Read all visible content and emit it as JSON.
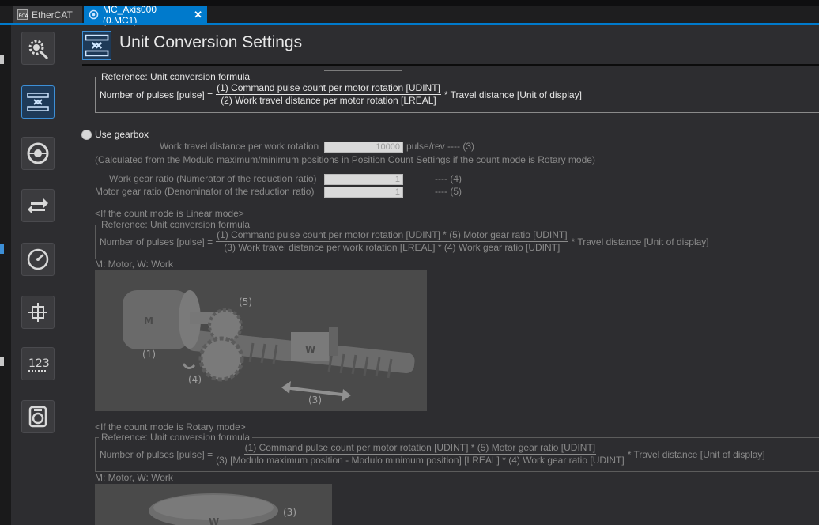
{
  "tabs": [
    {
      "label": "EtherCAT",
      "active": false,
      "icon": "ecat-icon"
    },
    {
      "label": "MC_Axis000 (0,MC1)",
      "active": true,
      "icon": "axis-icon",
      "close": "✕"
    }
  ],
  "sidebar": {
    "buttons": [
      {
        "name": "axis-basic-settings",
        "icon": "gear-icon"
      },
      {
        "name": "unit-conversion-settings",
        "icon": "unit-conversion-icon",
        "active": true
      },
      {
        "name": "operation-settings",
        "icon": "motor-icon"
      },
      {
        "name": "other-operation-settings",
        "icon": "arrows-icon"
      },
      {
        "name": "limit-settings",
        "icon": "speedometer-icon"
      },
      {
        "name": "homing-settings",
        "icon": "crosshair-icon"
      },
      {
        "name": "position-count-settings",
        "icon": "count-icon",
        "label": "123"
      },
      {
        "name": "servo-drive-settings",
        "icon": "servo-icon"
      }
    ]
  },
  "header": {
    "title": "Unit Conversion Settings"
  },
  "reference1": {
    "legend": "Reference: Unit conversion formula",
    "lhs": "Number of pulses [pulse] =",
    "numerator": "(1) Command pulse count per motor rotation [UDINT]",
    "denominator": "(2) Work travel distance per motor rotation [LREAL]",
    "rhs": "* Travel distance [Unit of display]"
  },
  "gearbox": {
    "label": "Use gearbox",
    "work_travel": {
      "label": "Work travel distance per work rotation",
      "value": "10000",
      "unit": "pulse/rev ---- (3)"
    },
    "calc_note": "(Calculated from the Modulo maximum/minimum positions in Position Count Settings if the count mode is Rotary mode)",
    "work_gear": {
      "label": "Work gear ratio (Numerator of the reduction ratio)",
      "value": "1",
      "ref": "---- (4)"
    },
    "motor_gear": {
      "label": "Motor gear ratio (Denominator of the reduction ratio)",
      "value": "1",
      "ref": "---- (5)"
    }
  },
  "linear": {
    "heading": "<If the count mode is Linear mode>",
    "legend": "Reference: Unit conversion formula",
    "lhs": "Number of pulses [pulse] =",
    "numerator": "(1) Command pulse count per motor rotation [UDINT] * (5) Motor gear ratio [UDINT]",
    "denominator": "(3) Work travel distance per work rotation [LREAL] * (4) Work gear ratio [UDINT]",
    "rhs": "* Travel distance [Unit of display]",
    "caption": "M: Motor, W: Work",
    "diagram_labels": {
      "m": "M",
      "w": "W",
      "l1": "(1)",
      "l3": "(3)",
      "l4": "(4)",
      "l5": "(5)"
    }
  },
  "rotary": {
    "heading": "<If the count mode is Rotary mode>",
    "legend": "Reference: Unit conversion formula",
    "lhs": "Number of pulses [pulse] =",
    "numerator": "(1) Command pulse count per motor rotation [UDINT] * (5) Motor gear ratio [UDINT]",
    "denominator": "(3) [Modulo maximum position - Modulo minimum position] [LREAL] * (4) Work gear ratio [UDINT]",
    "rhs": "* Travel distance [Unit of display]",
    "caption": "M: Motor, W: Work",
    "diagram_labels": {
      "w": "W",
      "l3": "(3)"
    }
  },
  "colors": {
    "accent": "#007acc",
    "background": "#2d2d30",
    "dim_text": "#8a8a8a"
  }
}
